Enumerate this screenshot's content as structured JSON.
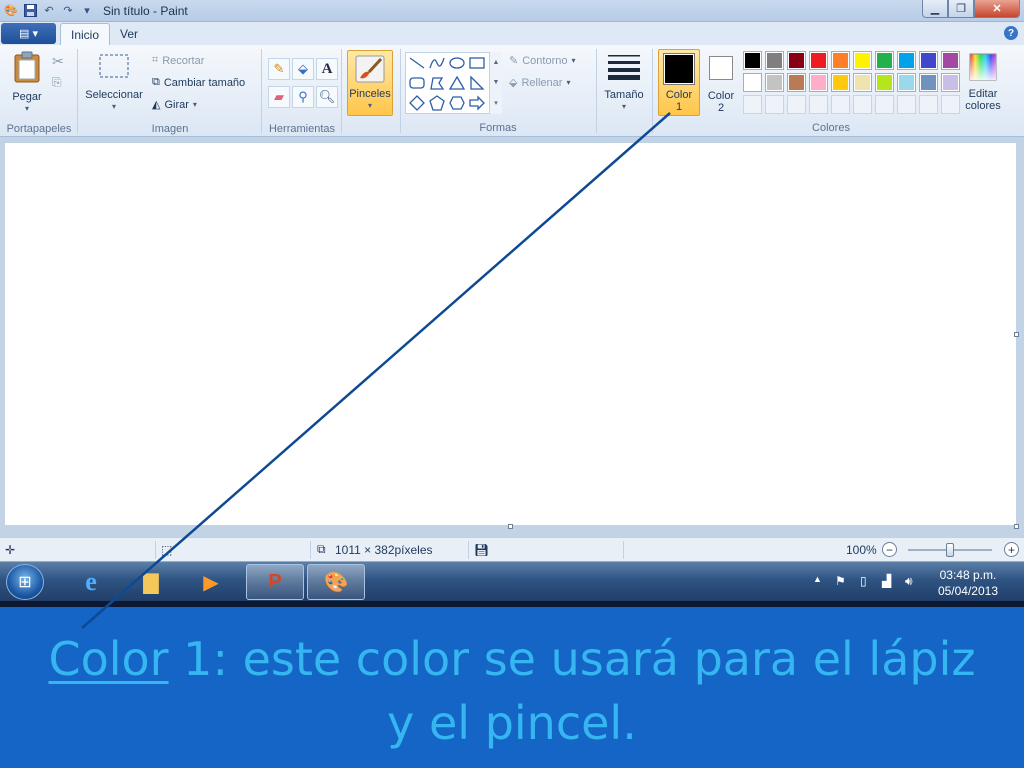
{
  "window": {
    "title": "Sin título - Paint"
  },
  "tabs": [
    {
      "label": "Inicio"
    },
    {
      "label": "Ver"
    }
  ],
  "ribbon": {
    "clipboard": {
      "group_label": "Portapapeles",
      "paste_label": "Pegar"
    },
    "image": {
      "group_label": "Imagen",
      "select_label": "Seleccionar",
      "crop_label": "Recortar",
      "resize_label": "Cambiar tamaño",
      "rotate_label": "Girar"
    },
    "tools": {
      "group_label": "Herramientas"
    },
    "brushes": {
      "label": "Pinceles"
    },
    "shapes": {
      "group_label": "Formas",
      "outline_label": "Contorno",
      "fill_label": "Rellenar"
    },
    "size": {
      "label": "Tamaño"
    },
    "colors": {
      "group_label": "Colores",
      "color1_label": "Color",
      "color1_num": "1",
      "color2_label": "Color",
      "color2_num": "2",
      "color1_value": "#000000",
      "color2_value": "#ffffff",
      "edit_label_1": "Editar",
      "edit_label_2": "colores",
      "palette_row1": [
        "#000000",
        "#7f7f7f",
        "#880015",
        "#ed1c24",
        "#ff7f27",
        "#fff200",
        "#22b14c",
        "#00a2e8",
        "#3f48cc",
        "#a349a4"
      ],
      "palette_row2": [
        "#ffffff",
        "#c3c3c3",
        "#b97a57",
        "#ffaec9",
        "#ffc90e",
        "#efe4b0",
        "#b5e61d",
        "#99d9ea",
        "#7092be",
        "#c8bfe7"
      ]
    }
  },
  "status": {
    "dimensions": "1011 × 382píxeles",
    "zoom": "100%"
  },
  "taskbar": {
    "time": "03:48 p.m.",
    "date": "05/04/2013"
  },
  "caption": {
    "term": "Color",
    "rest_line1": " 1:  este color se usará  para el lápiz",
    "line2": "y el pincel."
  }
}
